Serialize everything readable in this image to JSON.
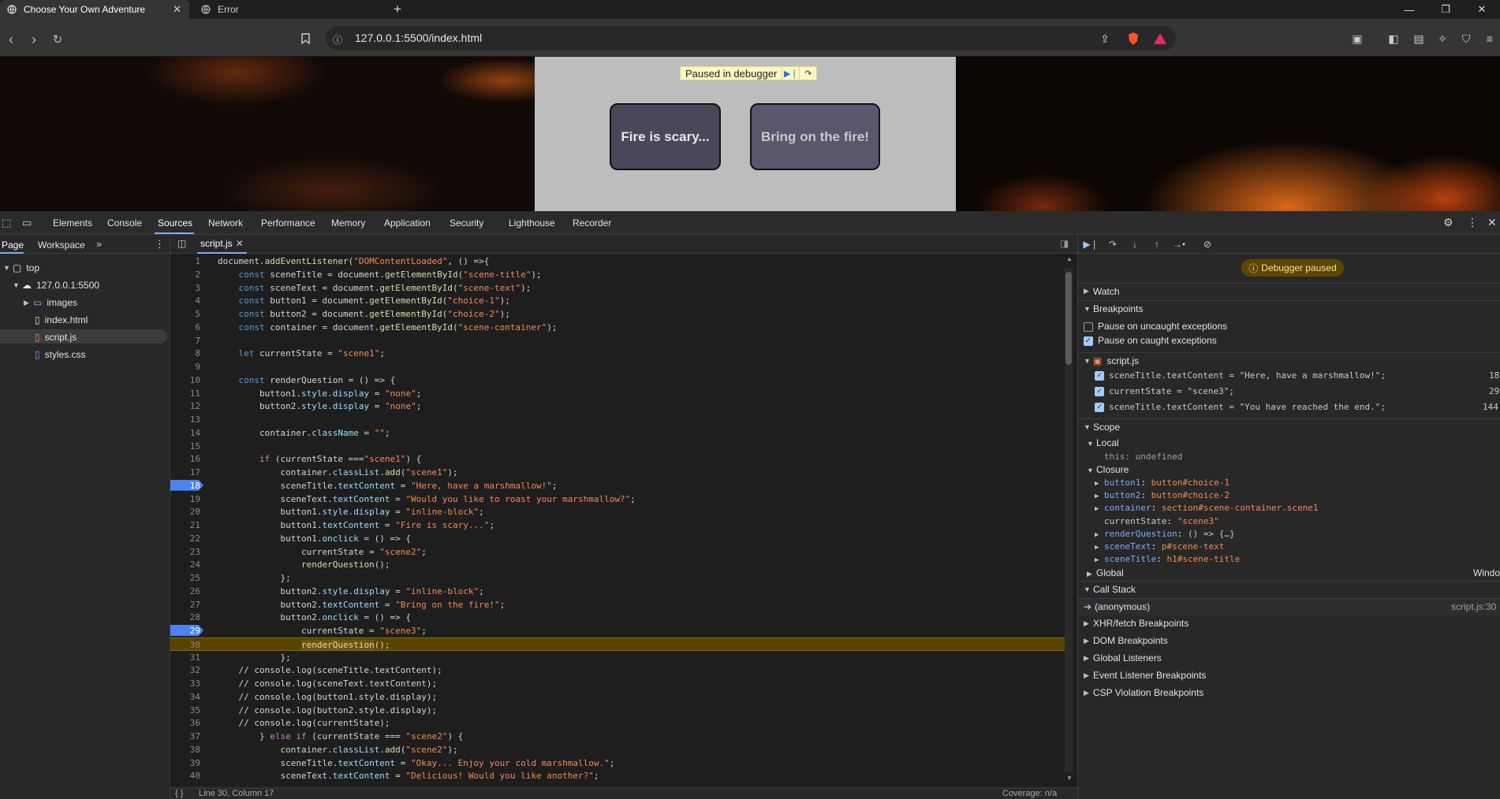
{
  "browser": {
    "tabs": [
      {
        "title": "Choose Your Own Adventure",
        "active": true
      },
      {
        "title": "Error",
        "active": false
      }
    ],
    "new_tab": "+",
    "url": "127.0.0.1:5500/index.html"
  },
  "page": {
    "paused_label": "Paused in debugger",
    "choice_1": "Fire is scary...",
    "choice_2": "Bring on the fire!"
  },
  "devtools": {
    "tabs": [
      "Elements",
      "Console",
      "Sources",
      "Network",
      "Performance",
      "Memory",
      "Application",
      "Security",
      "Lighthouse",
      "Recorder"
    ],
    "active_tab": "Sources",
    "navigator_tabs": [
      "Page",
      "Workspace"
    ],
    "tree": {
      "top": "top",
      "origin": "127.0.0.1:5500",
      "items": [
        "images",
        "index.html",
        "script.js",
        "styles.css"
      ]
    },
    "open_file": "script.js",
    "code_lines": [
      "document.addEventListener(\"DOMContentLoaded\", () =>{",
      "    const sceneTitle = document.getElementById(\"scene-title\");",
      "    const sceneText = document.getElementById(\"scene-text\");",
      "    const button1 = document.getElementById(\"choice-1\");",
      "    const button2 = document.getElementById(\"choice-2\");",
      "    const container = document.getElementById(\"scene-container\");",
      "",
      "    let currentState = \"scene1\";",
      "",
      "    const renderQuestion = () => {",
      "        button1.style.display = \"none\";",
      "        button2.style.display = \"none\";",
      "",
      "        container.className = \"\";",
      "",
      "        if (currentState ===\"scene1\") {",
      "            container.classList.add(\"scene1\");",
      "            sceneTitle.textContent = \"Here, have a marshmallow!\";",
      "            sceneText.textContent = \"Would you like to roast your marshmallow?\";",
      "            button1.style.display = \"inline-block\";",
      "            button1.textContent = \"Fire is scary...\";",
      "            button1.onclick = () => {",
      "                currentState = \"scene2\";",
      "                renderQuestion();",
      "            };",
      "            button2.style.display = \"inline-block\";",
      "            button2.textContent = \"Bring on the fire!\";",
      "            button2.onclick = () => {",
      "                currentState = \"scene3\";",
      "                renderQuestion();",
      "            };",
      "    // console.log(sceneTitle.textContent);",
      "    // console.log(sceneText.textContent);",
      "    // console.log(button1.style.display);",
      "    // console.log(button2.style.display);",
      "    // console.log(currentState);",
      "        } else if (currentState === \"scene2\") {",
      "            container.classList.add(\"scene2\");",
      "            sceneTitle.textContent = \"Okay... Enjoy your cold marshmallow.\";",
      "            sceneText.textContent = \"Delicious! Would you like another?\";"
    ],
    "breakpoint_lines": [
      18,
      29
    ],
    "execution_line": 30,
    "status": {
      "position": "Line 30, Column 17",
      "coverage": "Coverage: n/a"
    },
    "debugger": {
      "banner": "Debugger paused",
      "sections": {
        "watch": "Watch",
        "breakpoints": "Breakpoints",
        "scope": "Scope",
        "call_stack": "Call Stack"
      },
      "exceptions": [
        {
          "label": "Pause on uncaught exceptions",
          "checked": false
        },
        {
          "label": "Pause on caught exceptions",
          "checked": true
        }
      ],
      "bp_file": "script.js",
      "bp_list": [
        {
          "code": "sceneTitle.textContent = \"Here, have a marshmallow!\";",
          "line": "18"
        },
        {
          "code": "currentState = \"scene3\";",
          "line": "29"
        },
        {
          "code": "sceneTitle.textContent = \"You have reached the end.\";",
          "line": "144"
        }
      ],
      "scope_local": "Local",
      "this_key": "this",
      "this_val": "undefined",
      "scope_closure": "Closure",
      "closure": [
        {
          "key": "button1",
          "val": "button#choice-1",
          "expandable": true
        },
        {
          "key": "button2",
          "val": "button#choice-2",
          "expandable": true
        },
        {
          "key": "container",
          "val": "section#scene-container.scene1",
          "expandable": true
        },
        {
          "key": "currentState",
          "val": "\"scene3\"",
          "expandable": false
        },
        {
          "key": "renderQuestion",
          "val": "() => {…}",
          "expandable": true
        },
        {
          "key": "sceneText",
          "val": "p#scene-text",
          "expandable": true
        },
        {
          "key": "sceneTitle",
          "val": "h1#scene-title",
          "expandable": true
        }
      ],
      "scope_global": "Global",
      "global_val": "Windo",
      "callstack_fn": "(anonymous)",
      "callstack_loc": "script.js:30",
      "more_sections": [
        "XHR/fetch Breakpoints",
        "DOM Breakpoints",
        "Global Listeners",
        "Event Listener Breakpoints",
        "CSP Violation Breakpoints"
      ]
    }
  }
}
